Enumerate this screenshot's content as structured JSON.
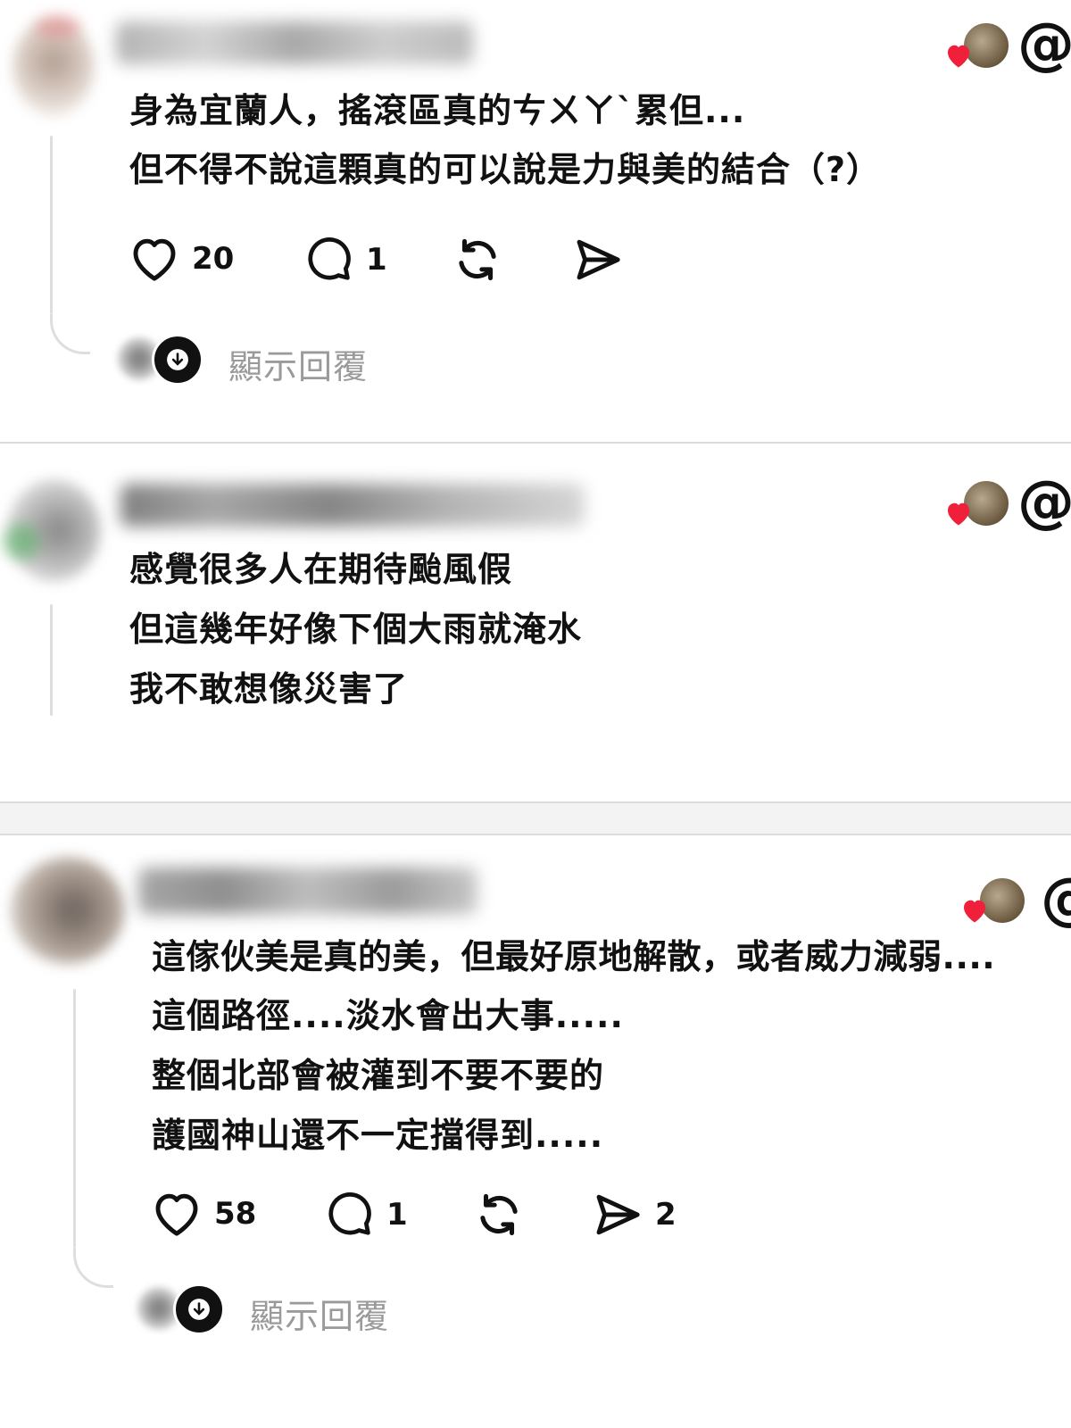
{
  "posts": [
    {
      "body": [
        "身為宜蘭人，搖滾區真的ㄘㄨㄚˋ累但...",
        "但不得不說這顆真的可以說是力與美的結合（?）"
      ],
      "likes": "20",
      "comments": "1",
      "shares": "",
      "show_replies": "顯示回覆"
    },
    {
      "body": [
        "感覺很多人在期待颱風假",
        "但這幾年好像下個大雨就淹水",
        "我不敢想像災害了"
      ]
    },
    {
      "body": [
        "這傢伙美是真的美，但最好原地解散，或者威力減弱....",
        "這個路徑....淡水會出大事.....",
        "整個北部會被灌到不要不要的",
        "護國神山還不一定擋得到....."
      ],
      "likes": "58",
      "comments": "1",
      "shares": "2",
      "show_replies": "顯示回覆"
    }
  ],
  "icons": {
    "like": "heart-outline-icon",
    "comment": "speech-bubble-icon",
    "repost": "repost-arrows-icon",
    "share": "paper-plane-icon",
    "liked": "heart-filled-icon",
    "app_logo": "threads-at-logo"
  },
  "threads_logo": "@",
  "colors": {
    "heart_red": "#f0203b",
    "muted_text": "#9a9a9a",
    "connector": "#dedede"
  }
}
